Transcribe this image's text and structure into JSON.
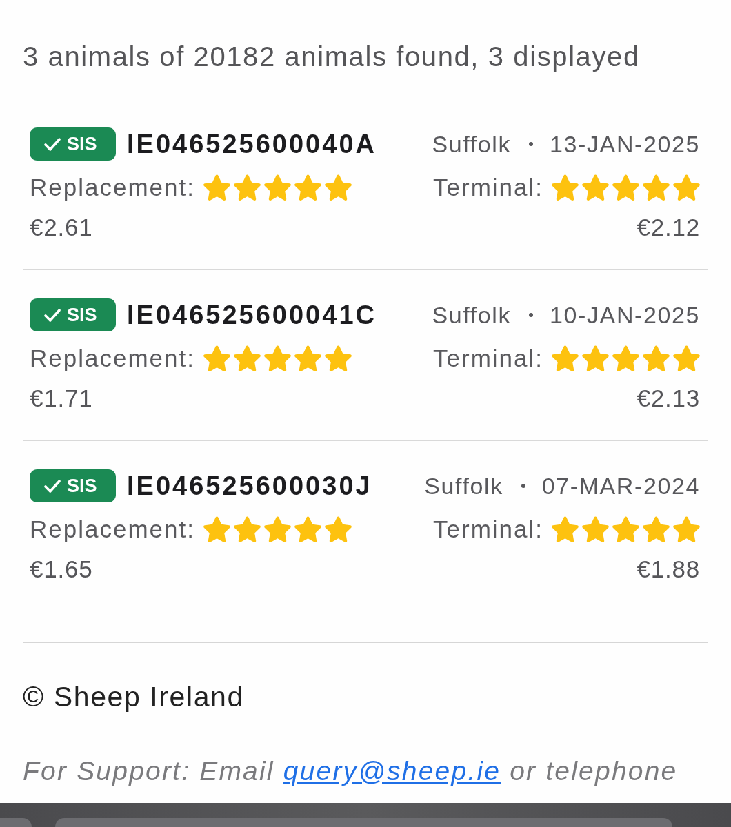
{
  "summary": "3 animals of 20182 animals found, 3 displayed",
  "animals": [
    {
      "badge": "SIS",
      "tag": "IE046525600040A",
      "breed": "Suffolk",
      "date": "13-JAN-2025",
      "replacement": {
        "label": "Replacement:",
        "stars": 5,
        "value": "€2.61"
      },
      "terminal": {
        "label": "Terminal:",
        "stars": 5,
        "value": "€2.12"
      }
    },
    {
      "badge": "SIS",
      "tag": "IE046525600041C",
      "breed": "Suffolk",
      "date": "10-JAN-2025",
      "replacement": {
        "label": "Replacement:",
        "stars": 5,
        "value": "€1.71"
      },
      "terminal": {
        "label": "Terminal:",
        "stars": 5,
        "value": "€2.13"
      }
    },
    {
      "badge": "SIS",
      "tag": "IE046525600030J",
      "breed": "Suffolk",
      "date": "07-MAR-2024",
      "replacement": {
        "label": "Replacement:",
        "stars": 5,
        "value": "€1.65"
      },
      "terminal": {
        "label": "Terminal:",
        "stars": 5,
        "value": "€1.88"
      }
    }
  ],
  "footer": {
    "copyright": "© Sheep Ireland",
    "support": {
      "text": "For Support: Email",
      "link": "query@sheep.ie",
      "text_after": "or telephone"
    }
  }
}
